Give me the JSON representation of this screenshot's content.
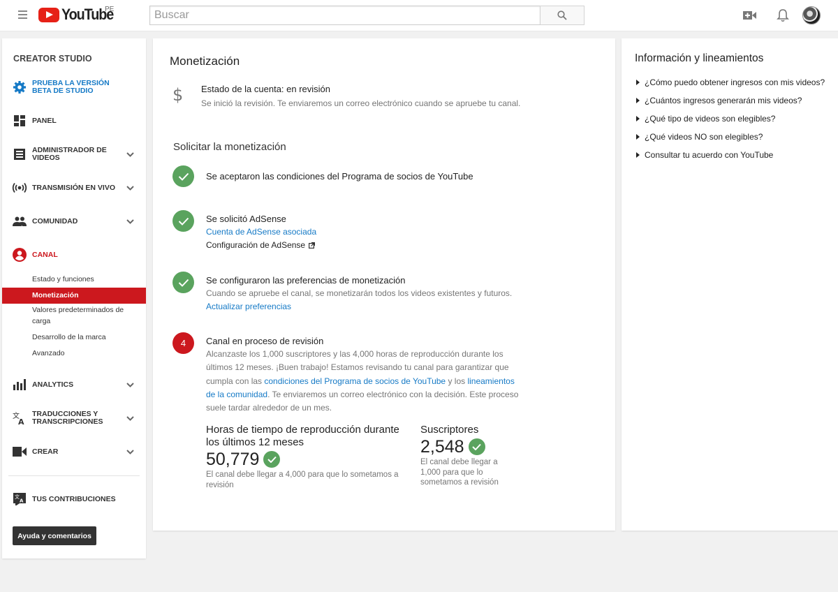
{
  "header": {
    "logo_text": "YouTube",
    "country": "PE",
    "search_placeholder": "Buscar"
  },
  "sidebar": {
    "title": "CREATOR STUDIO",
    "beta": "PRUEBA LA VERSIÓN BETA DE STUDIO",
    "items": [
      {
        "label": "PANEL"
      },
      {
        "label": "ADMINISTRADOR DE VIDEOS"
      },
      {
        "label": "TRANSMISIÓN EN VIVO"
      },
      {
        "label": "COMUNIDAD"
      },
      {
        "label": "CANAL"
      },
      {
        "label": "ANALYTICS"
      },
      {
        "label": "TRADUCCIONES Y TRANSCRIPCIONES"
      },
      {
        "label": "CREAR"
      },
      {
        "label": "TUS CONTRIBUCIONES"
      }
    ],
    "canal_sub": [
      "Estado y funciones",
      "Monetización",
      "Valores predeterminados de carga",
      "Desarrollo de la marca",
      "Avanzado"
    ],
    "help_button": "Ayuda y comentarios"
  },
  "main": {
    "title": "Monetización",
    "status": {
      "title": "Estado de la cuenta: en revisión",
      "desc": "Se inició la revisión. Te enviaremos un correo electrónico cuando se apruebe tu canal."
    },
    "section_title": "Solicitar la monetización",
    "steps": [
      {
        "title": "Se aceptaron las condiciones del Programa de socios de YouTube"
      },
      {
        "title": "Se solicitó AdSense",
        "link1": "Cuenta de AdSense asociada",
        "link2": "Configuración de AdSense"
      },
      {
        "title": "Se configuraron las preferencias de monetización",
        "desc": "Cuando se apruebe el canal, se monetizarán todos los videos existentes y futuros.",
        "link": "Actualizar preferencias"
      },
      {
        "number": "4",
        "title": "Canal en proceso de revisión",
        "desc_a": "Alcanzaste los 1,000 suscriptores y las 4,000 horas de reproducción durante los últimos 12 meses. ¡Buen trabajo! Estamos revisando tu canal para garantizar que cumpla con las ",
        "link_a": "condiciones del Programa de socios de YouTube",
        "desc_b": " y los ",
        "link_b": "lineamientos de la comunidad",
        "desc_c": ". Te enviaremos un correo electrónico con la decisión. Este proceso suele tardar alrededor de un mes."
      }
    ],
    "metrics": {
      "hours_label": "Horas de tiempo de reproducción durante los últimos 12 meses",
      "hours_value": "50,779",
      "hours_note": "El canal debe llegar a 4,000 para que lo sometamos a revisión",
      "subs_label": "Suscriptores",
      "subs_value": "2,548",
      "subs_note": "El canal debe llegar a 1,000 para que lo sometamos a revisión"
    }
  },
  "right_panel": {
    "title": "Información y lineamientos",
    "items": [
      "¿Cómo puedo obtener ingresos con mis videos?",
      "¿Cuántos ingresos generarán mis videos?",
      "¿Qué tipo de videos son elegibles?",
      "¿Qué videos NO son elegibles?",
      "Consultar tu acuerdo con YouTube"
    ]
  },
  "colors": {
    "accent_red": "#cc181e",
    "link_blue": "#167ac6",
    "success_green": "#5aa35e"
  },
  "icons": [
    "menu-icon",
    "search-icon",
    "upload-video-icon",
    "bell-icon",
    "gear-icon",
    "dashboard-icon",
    "video-manager-icon",
    "live-icon",
    "community-icon",
    "channel-icon",
    "analytics-icon",
    "translate-icon",
    "camera-icon",
    "check-icon",
    "external-link-icon",
    "dollar-icon",
    "triangle-right-icon",
    "chevron-down-icon"
  ]
}
